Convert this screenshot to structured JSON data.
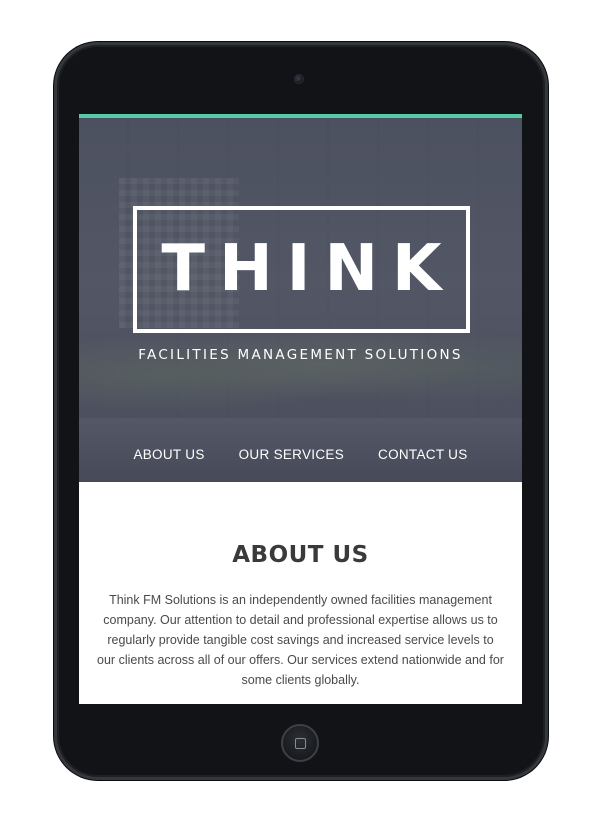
{
  "site": {
    "logo_text": "THINK",
    "tagline": "FACILITIES MANAGEMENT SOLUTIONS",
    "accent_color": "#56c9a6"
  },
  "nav": {
    "items": [
      {
        "label": "ABOUT US"
      },
      {
        "label": "OUR SERVICES"
      },
      {
        "label": "CONTACT US"
      }
    ]
  },
  "about": {
    "title": "ABOUT US",
    "body": "Think FM Solutions is an independently owned facilities management company. Our attention to detail and professional expertise allows us to regularly provide tangible cost savings and increased service levels to our clients across all of our offers. Our services extend nationwide and for some clients globally."
  },
  "device": {
    "camera_icon": "camera-icon",
    "home_icon": "home-button-icon"
  }
}
